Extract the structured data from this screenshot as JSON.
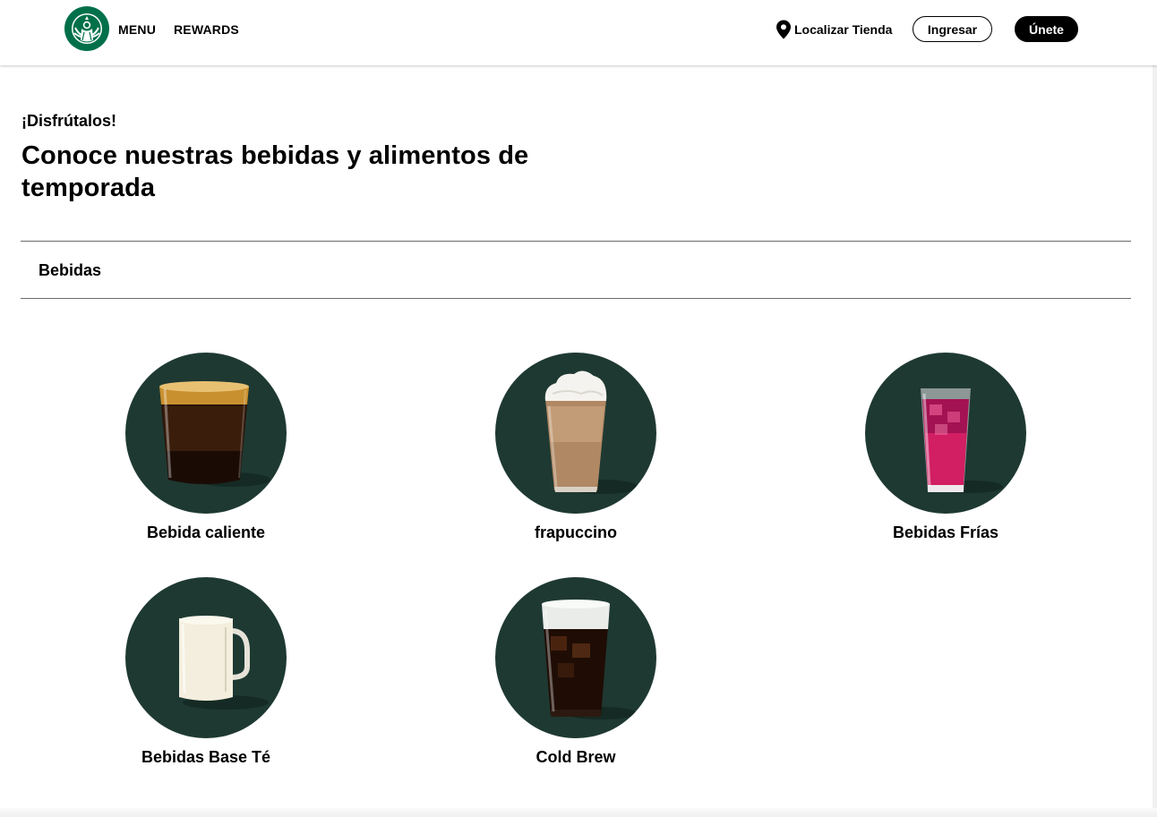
{
  "header": {
    "logo": "starbucks-siren-logo",
    "nav": [
      {
        "label": "MENU"
      },
      {
        "label": "REWARDS"
      }
    ],
    "store_locator": {
      "label": "Localizar Tienda",
      "icon": "location-pin-icon"
    },
    "signin_label": "Ingresar",
    "join_label": "Únete"
  },
  "hero": {
    "eyebrow": "¡Disfrútalos!",
    "title": "Conoce nuestras bebidas y alimentos de temporada"
  },
  "section": {
    "label": "Bebidas"
  },
  "categories": [
    {
      "label": "Bebida caliente",
      "image": "hot-coffee-glass"
    },
    {
      "label": "frapuccino",
      "image": "frappuccino-whipped-cream"
    },
    {
      "label": "Bebidas Frías",
      "image": "iced-pink-drink"
    },
    {
      "label": "Bebidas Base Té",
      "image": "tea-latte-mug"
    },
    {
      "label": "Cold Brew",
      "image": "cold-brew-cold-foam"
    }
  ],
  "colors": {
    "brand_green": "#1e3932",
    "siren_green": "#00704a",
    "text": "#000000",
    "divider": "#6b6b6b"
  }
}
